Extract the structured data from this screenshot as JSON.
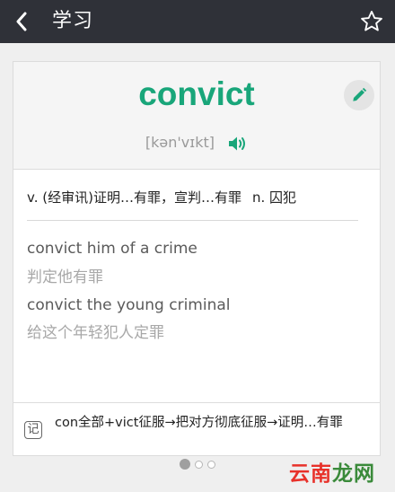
{
  "header": {
    "title": "学习"
  },
  "word": {
    "text": "convict",
    "phonetic": "[kən'vɪkt]"
  },
  "definition": {
    "verb": "v. (经审讯)证明…有罪，宣判…有罪",
    "noun": "n. 囚犯"
  },
  "examples": [
    {
      "en": "convict him of a crime",
      "zh": "判定他有罪"
    },
    {
      "en": "convict the young criminal",
      "zh": "给这个年轻犯人定罪"
    }
  ],
  "mnemonic": {
    "icon_label": "记",
    "text": "con全部+vict征服→把对方彻底征服→证明…有罪"
  },
  "pagination": {
    "active_index": 0,
    "count": 3
  },
  "watermark": {
    "part1": "云南",
    "part2": "龙网"
  },
  "colors": {
    "topbar": "#2f3138",
    "accent": "#19a67a"
  }
}
